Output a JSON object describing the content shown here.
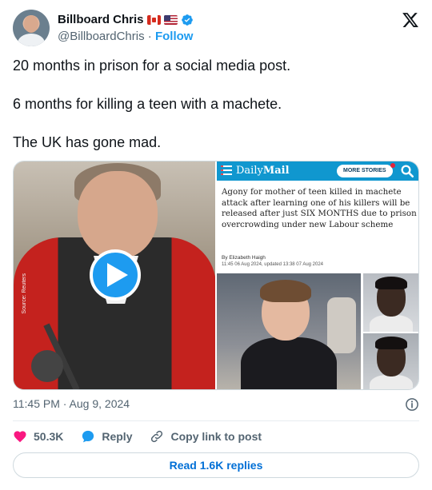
{
  "author": {
    "name": "Billboard Chris",
    "handle": "@BillboardChris",
    "separator": "·",
    "follow_label": "Follow"
  },
  "icons": {
    "flags": [
      "canada-flag-icon",
      "usa-flag-icon"
    ],
    "verified": "verified-badge-icon",
    "platform": "x-logo-icon",
    "play": "play-icon",
    "info": "info-icon",
    "like": "heart-icon",
    "reply": "reply-bubble-icon",
    "copy_link": "link-icon"
  },
  "tweet": {
    "lines": [
      "20 months in prison for a social media post.",
      "6 months for killing a teen with a machete.",
      "The UK has gone mad."
    ]
  },
  "media": {
    "video": {
      "source_watermark": "Source: Reuters"
    },
    "article": {
      "logo_prefix": "Daily",
      "logo_main": "Mail",
      "more_stories_label": "MORE STORIES",
      "headline": "Agony for mother of teen killed in machete attack after learning one of his killers will be released after just SIX MONTHS due to prison overcrowding under new Labour scheme",
      "byline": "By Elizabeth Haigh",
      "dates": "11:45 06 Aug 2024, updated 13:38 07 Aug 2024"
    }
  },
  "meta": {
    "timestamp": "11:45 PM · Aug 9, 2024"
  },
  "actions": {
    "like_count": "50.3K",
    "reply_label": "Reply",
    "copy_link_label": "Copy link to post"
  },
  "footer": {
    "read_replies_label": "Read 1.6K replies"
  },
  "colors": {
    "accent": "#1d9bf0",
    "link": "#006fd6",
    "like": "#f91880",
    "muted_text": "#536471",
    "dm_blue": "#1097cf"
  }
}
